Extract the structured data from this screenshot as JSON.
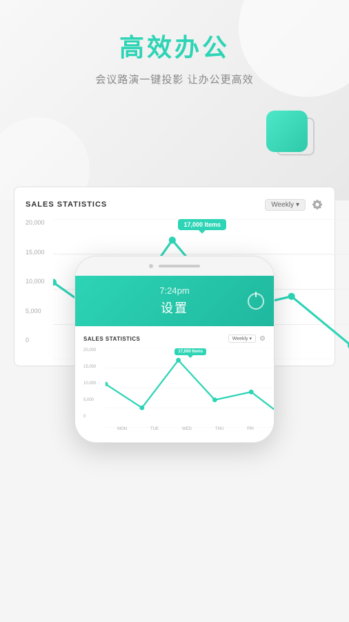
{
  "header": {
    "title": "高效办公",
    "subtitle": "会议路演一键投影 让办公更高效"
  },
  "chart_bg": {
    "title": "SALES STATISTICS",
    "weekly_label": "Weekly",
    "y_labels": [
      "20,000",
      "15,000",
      "10,000",
      "5,000",
      "0"
    ],
    "tooltip_text": "17,000 Items"
  },
  "phone": {
    "time": "7:24pm",
    "settings_label": "设置",
    "chart": {
      "title": "SALES STATISTICS",
      "weekly_label": "Weekly",
      "tooltip_text": "17,000 Items",
      "y_labels": [
        "20,000",
        "15,000",
        "10,000",
        "5,000",
        "0"
      ],
      "x_labels": [
        "MON",
        "TUE",
        "WED",
        "THU",
        "FRI"
      ]
    }
  }
}
